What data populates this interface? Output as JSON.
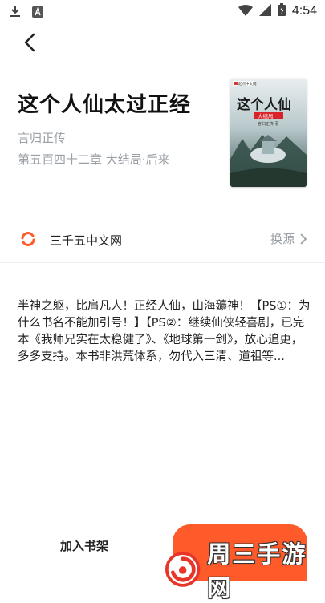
{
  "status_bar": {
    "time": "4:54"
  },
  "book": {
    "title": "这个人仙太过正经",
    "author": "言归正传",
    "latest_chapter": "第五百四十二章 大结局·后来",
    "cover": {
      "title_art": "这个人仙",
      "badge": "大结局",
      "publisher": "起点中文网",
      "author_small": "言归正传 著"
    }
  },
  "source": {
    "name": "三千五中文网",
    "switch_label": "换源"
  },
  "description": "半神之躯，比肩凡人！正经人仙，山海薅神！【PS①：为什么书名不能加引号！】【PS②：继续仙侠轻喜剧，已完本《我师兄实在太稳健了》、《地球第一剑》，放心追更，多多支持。本书非洪荒体系，勿代入三清、道祖等...",
  "bottom": {
    "add_to_shelf": "加入书架"
  },
  "watermark": {
    "text": "周三手游网"
  },
  "colors": {
    "accent": "#ff5a2a",
    "muted": "#9aa0a6"
  }
}
